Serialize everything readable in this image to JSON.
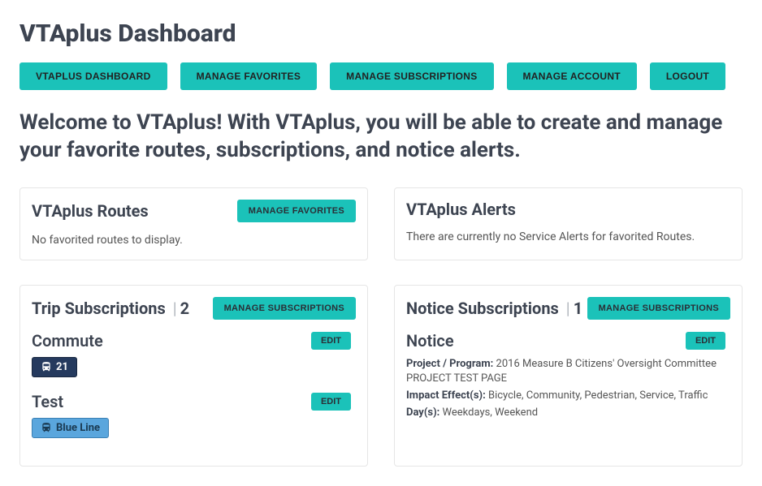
{
  "page_title": "VTAplus Dashboard",
  "nav": {
    "dashboard": "VTAPLUS DASHBOARD",
    "favorites": "MANAGE FAVORITES",
    "subscriptions": "MANAGE SUBSCRIPTIONS",
    "account": "MANAGE ACCOUNT",
    "logout": "LOGOUT"
  },
  "welcome": "Welcome to VTAplus! With VTAplus, you will be able to create and manage your favorite routes, subscriptions, and notice alerts.",
  "routes_card": {
    "title": "VTAplus Routes",
    "action": "MANAGE FAVORITES",
    "empty": "No favorited routes to display."
  },
  "alerts_card": {
    "title": "VTAplus Alerts",
    "empty": "There are currently no Service Alerts for favorited Routes."
  },
  "trip_subs": {
    "title": "Trip Subscriptions",
    "count": "2",
    "action": "MANAGE SUBSCRIPTIONS",
    "edit_label": "EDIT",
    "items": [
      {
        "name": "Commute",
        "route_label": "21",
        "route_icon": "bus-icon",
        "pill_style": "dark"
      },
      {
        "name": "Test",
        "route_label": "Blue Line",
        "route_icon": "rail-icon",
        "pill_style": "blue"
      }
    ]
  },
  "notice_subs": {
    "title": "Notice Subscriptions",
    "count": "1",
    "action": "MANAGE SUBSCRIPTIONS",
    "edit_label": "EDIT",
    "items": [
      {
        "name": "Notice",
        "project_label": "Project / Program:",
        "project_value": "2016 Measure B Citizens' Oversight Committee PROJECT TEST PAGE",
        "impact_label": "Impact Effect(s):",
        "impact_value": "Bicycle, Community, Pedestrian, Service, Traffic",
        "days_label": "Day(s):",
        "days_value": "Weekdays, Weekend"
      }
    ]
  }
}
